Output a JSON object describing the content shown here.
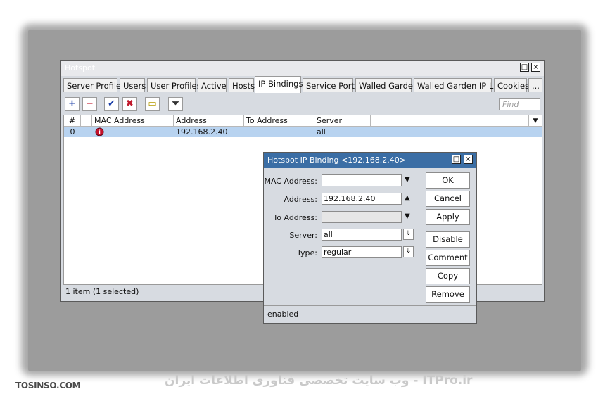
{
  "main_window": {
    "title": "Hotspot",
    "maximize_icon": "□",
    "close_icon": "×",
    "tabs": [
      "Server Profiles",
      "Users",
      "User Profiles",
      "Active",
      "Hosts",
      "IP Bindings",
      "Service Ports",
      "Walled Garden",
      "Walled Garden IP List",
      "Cookies",
      "..."
    ],
    "active_tab": "IP Bindings",
    "toolbar": {
      "add": "+",
      "remove": "−",
      "enable": "✔",
      "disable": "✖",
      "comment": "▭",
      "filter": "⏷"
    },
    "find_placeholder": "Find",
    "columns": [
      "#",
      "MAC Address",
      "Address",
      "To Address",
      "Server"
    ],
    "rows": [
      {
        "num": "0",
        "mac": "",
        "address": "192.168.2.40",
        "to_address": "",
        "server": "all"
      }
    ],
    "status": "1 item (1 selected)"
  },
  "dialog": {
    "title": "Hotspot IP Binding <192.168.2.40>",
    "fields": {
      "mac_label": "MAC Address:",
      "mac_value": "",
      "address_label": "Address:",
      "address_value": "192.168.2.40",
      "to_address_label": "To Address:",
      "to_address_value": "",
      "server_label": "Server:",
      "server_value": "all",
      "type_label": "Type:",
      "type_value": "regular"
    },
    "buttons": {
      "ok": "OK",
      "cancel": "Cancel",
      "apply": "Apply",
      "disable": "Disable",
      "comment": "Comment",
      "copy": "Copy",
      "remove": "Remove"
    },
    "status": "enabled"
  },
  "watermarks": {
    "left": "TOSINSO.COM",
    "center": "وب سایت تخصصی فناوری اطلاعات ایران - ITPro.ir"
  },
  "colors": {
    "selection": "#b8d3f0",
    "dialog_titlebar": "#3b6ea5",
    "add_icon": "#1b3fa8",
    "remove_icon": "#c0182b"
  }
}
